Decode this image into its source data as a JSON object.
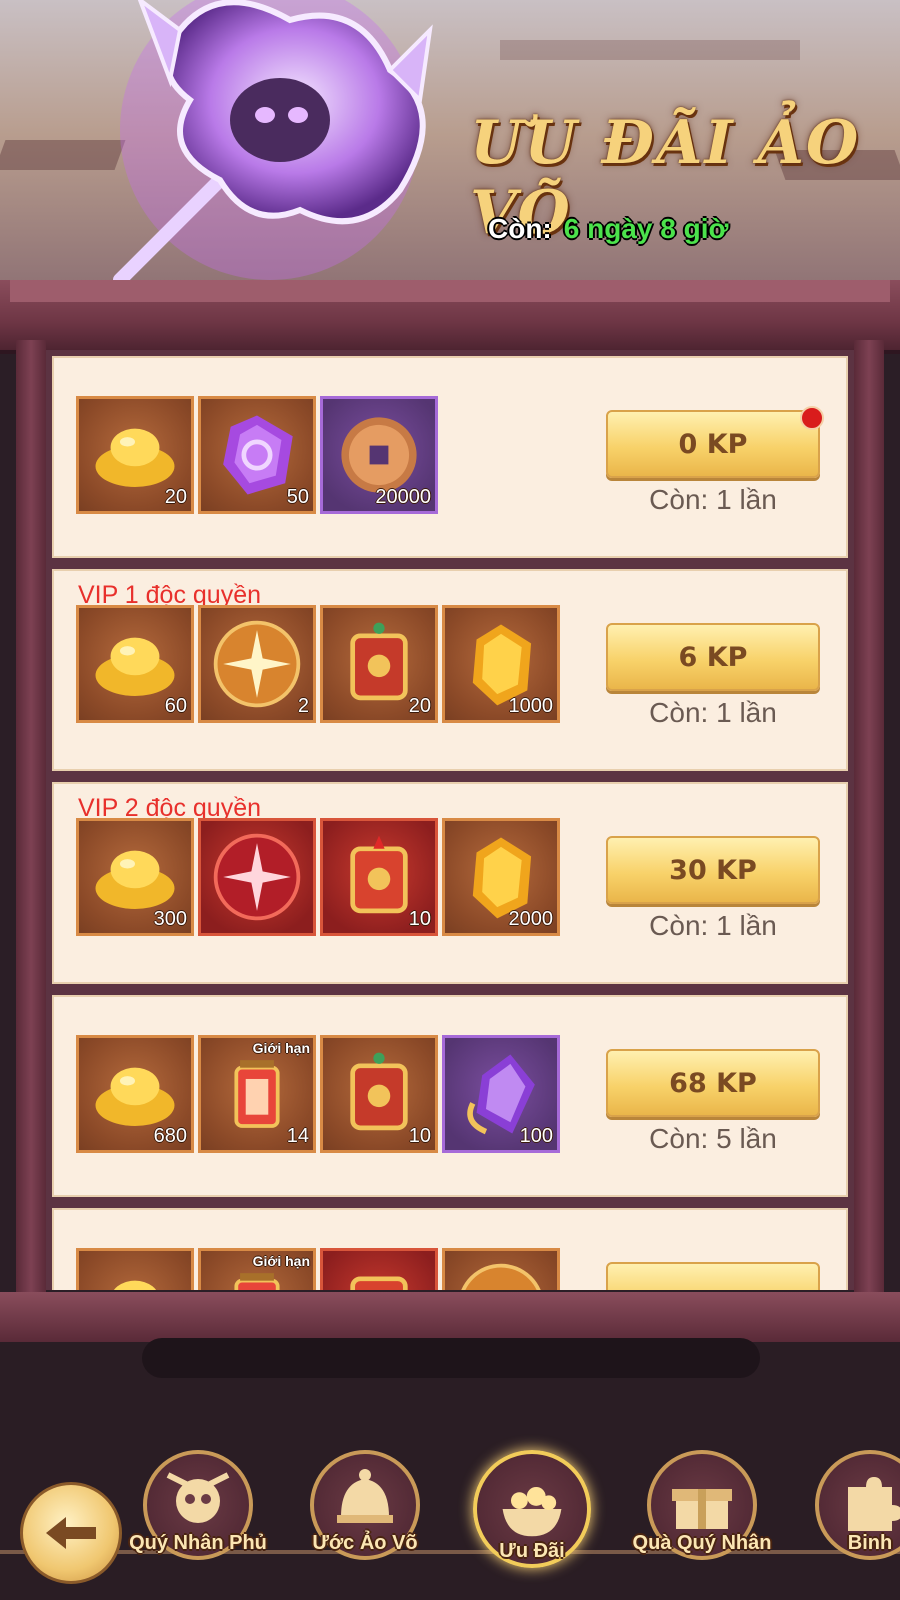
{
  "banner": {
    "title": "ƯU ĐÃI ẢO VÕ",
    "countdown_label": "Còn:",
    "countdown_value": "6 ngày 8 giờ"
  },
  "offers": [
    {
      "label": "",
      "price": "0 KP",
      "remaining": "Còn: 1 lần",
      "has_notification": true,
      "items": [
        {
          "icon": "gold-ingot-icon",
          "count": "20",
          "rarity": "orange"
        },
        {
          "icon": "purple-gem-icon",
          "count": "50",
          "rarity": "orange"
        },
        {
          "icon": "copper-coin-icon",
          "count": "20000",
          "rarity": "purple"
        }
      ]
    },
    {
      "label": "VIP 1 độc quyền",
      "price": "6 KP",
      "remaining": "Còn: 1 lần",
      "has_notification": false,
      "items": [
        {
          "icon": "gold-ingot-icon",
          "count": "60",
          "rarity": "orange"
        },
        {
          "icon": "orange-star-orb-icon",
          "count": "2",
          "rarity": "orange"
        },
        {
          "icon": "talisman-icon",
          "count": "20",
          "rarity": "orange"
        },
        {
          "icon": "yellow-crystal-icon",
          "count": "1000",
          "rarity": "orange"
        }
      ]
    },
    {
      "label": "VIP 2 độc quyền",
      "price": "30 KP",
      "remaining": "Còn: 1 lần",
      "has_notification": false,
      "items": [
        {
          "icon": "gold-ingot-icon",
          "count": "300",
          "rarity": "orange"
        },
        {
          "icon": "red-star-orb-icon",
          "count": "",
          "rarity": "red"
        },
        {
          "icon": "red-talisman-icon",
          "count": "10",
          "rarity": "red"
        },
        {
          "icon": "yellow-crystal-icon",
          "count": "2000",
          "rarity": "orange"
        }
      ]
    },
    {
      "label": "",
      "price": "68 KP",
      "remaining": "Còn: 5 lần",
      "has_notification": false,
      "items": [
        {
          "icon": "gold-ingot-icon",
          "count": "680",
          "rarity": "orange"
        },
        {
          "icon": "lantern-icon",
          "count": "14",
          "rarity": "orange",
          "tag": "Giới hạn"
        },
        {
          "icon": "talisman-icon",
          "count": "10",
          "rarity": "orange"
        },
        {
          "icon": "purple-crystal-icon",
          "count": "100",
          "rarity": "purple"
        }
      ]
    },
    {
      "label": "",
      "price": "",
      "remaining": "",
      "has_notification": false,
      "items": [
        {
          "icon": "gold-ingot-icon",
          "count": "",
          "rarity": "orange"
        },
        {
          "icon": "lantern-icon",
          "count": "",
          "rarity": "orange",
          "tag": "Giới hạn"
        },
        {
          "icon": "red-talisman-icon",
          "count": "",
          "rarity": "red"
        },
        {
          "icon": "orange-star-orb-icon",
          "count": "",
          "rarity": "orange"
        }
      ]
    }
  ],
  "nav": {
    "items": [
      {
        "label": "Quý Nhân Phủ",
        "icon": "skull-axe-icon",
        "active": false
      },
      {
        "label": "Ước Ảo Võ",
        "icon": "helmet-icon",
        "active": false
      },
      {
        "label": "Ưu Đãi",
        "icon": "treasure-bowl-icon",
        "active": true
      },
      {
        "label": "Quà Quý Nhân",
        "icon": "gift-chest-icon",
        "active": false
      },
      {
        "label": "Binh",
        "icon": "puzzle-icon",
        "active": false
      }
    ]
  },
  "colors": {
    "accent_gold": "#f8d26a",
    "vip_label": "#e8302c",
    "countdown_value": "#4ce24c",
    "cabinet": "#7d4153"
  }
}
